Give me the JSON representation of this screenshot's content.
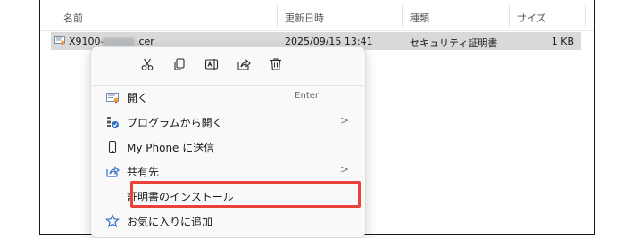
{
  "columns": {
    "name": "名前",
    "modified": "更新日時",
    "type": "種類",
    "size": "サイズ"
  },
  "file": {
    "name_prefix": "X9100-",
    "name_suffix": ".cer",
    "modified": "2025/09/15 13:41",
    "type": "セキュリティ証明書",
    "size": "1 KB"
  },
  "toolbar": {
    "icons": [
      "cut-icon",
      "copy-icon",
      "rename-icon",
      "share-icon",
      "delete-icon"
    ]
  },
  "menu": {
    "open": {
      "label": "開く",
      "shortcut": "Enter"
    },
    "open_with": {
      "label": "プログラムから開く",
      "arrow": ">"
    },
    "send_phone": {
      "label": "My Phone に送信"
    },
    "share": {
      "label": "共有先",
      "arrow": ">"
    },
    "install_cert": {
      "label": "証明書のインストール"
    },
    "favorites": {
      "label": "お気に入りに追加"
    }
  },
  "colors": {
    "highlight": "#e8423a",
    "selected_row": "#d9d9d9",
    "accent": "#2f6fc7"
  }
}
